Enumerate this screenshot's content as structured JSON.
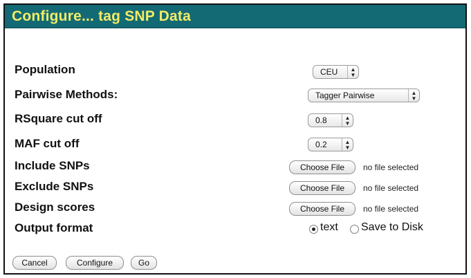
{
  "title": "Configure... tag SNP Data",
  "rows": {
    "population": {
      "label": "Population",
      "value": "CEU"
    },
    "pairwise": {
      "label": "Pairwise Methods:",
      "value": "Tagger Pairwise"
    },
    "rsquare": {
      "label": "RSquare cut off",
      "value": "0.8"
    },
    "maf": {
      "label": "MAF cut off",
      "value": "0.2"
    },
    "include": {
      "label": "Include SNPs",
      "button": "Choose File",
      "status": "no file selected"
    },
    "exclude": {
      "label": "Exclude SNPs",
      "button": "Choose File",
      "status": "no file selected"
    },
    "design": {
      "label": "Design scores",
      "button": "Choose File",
      "status": "no file selected"
    },
    "output": {
      "label": "Output format",
      "options": [
        "text",
        "Save to Disk"
      ],
      "selected": "text"
    }
  },
  "actions": {
    "cancel": "Cancel",
    "configure": "Configure",
    "go": "Go"
  },
  "colors": {
    "title_bg": "#136a74",
    "title_text": "#f2ec66"
  },
  "icons": {
    "select_arrows": "updown-arrows-icon"
  }
}
